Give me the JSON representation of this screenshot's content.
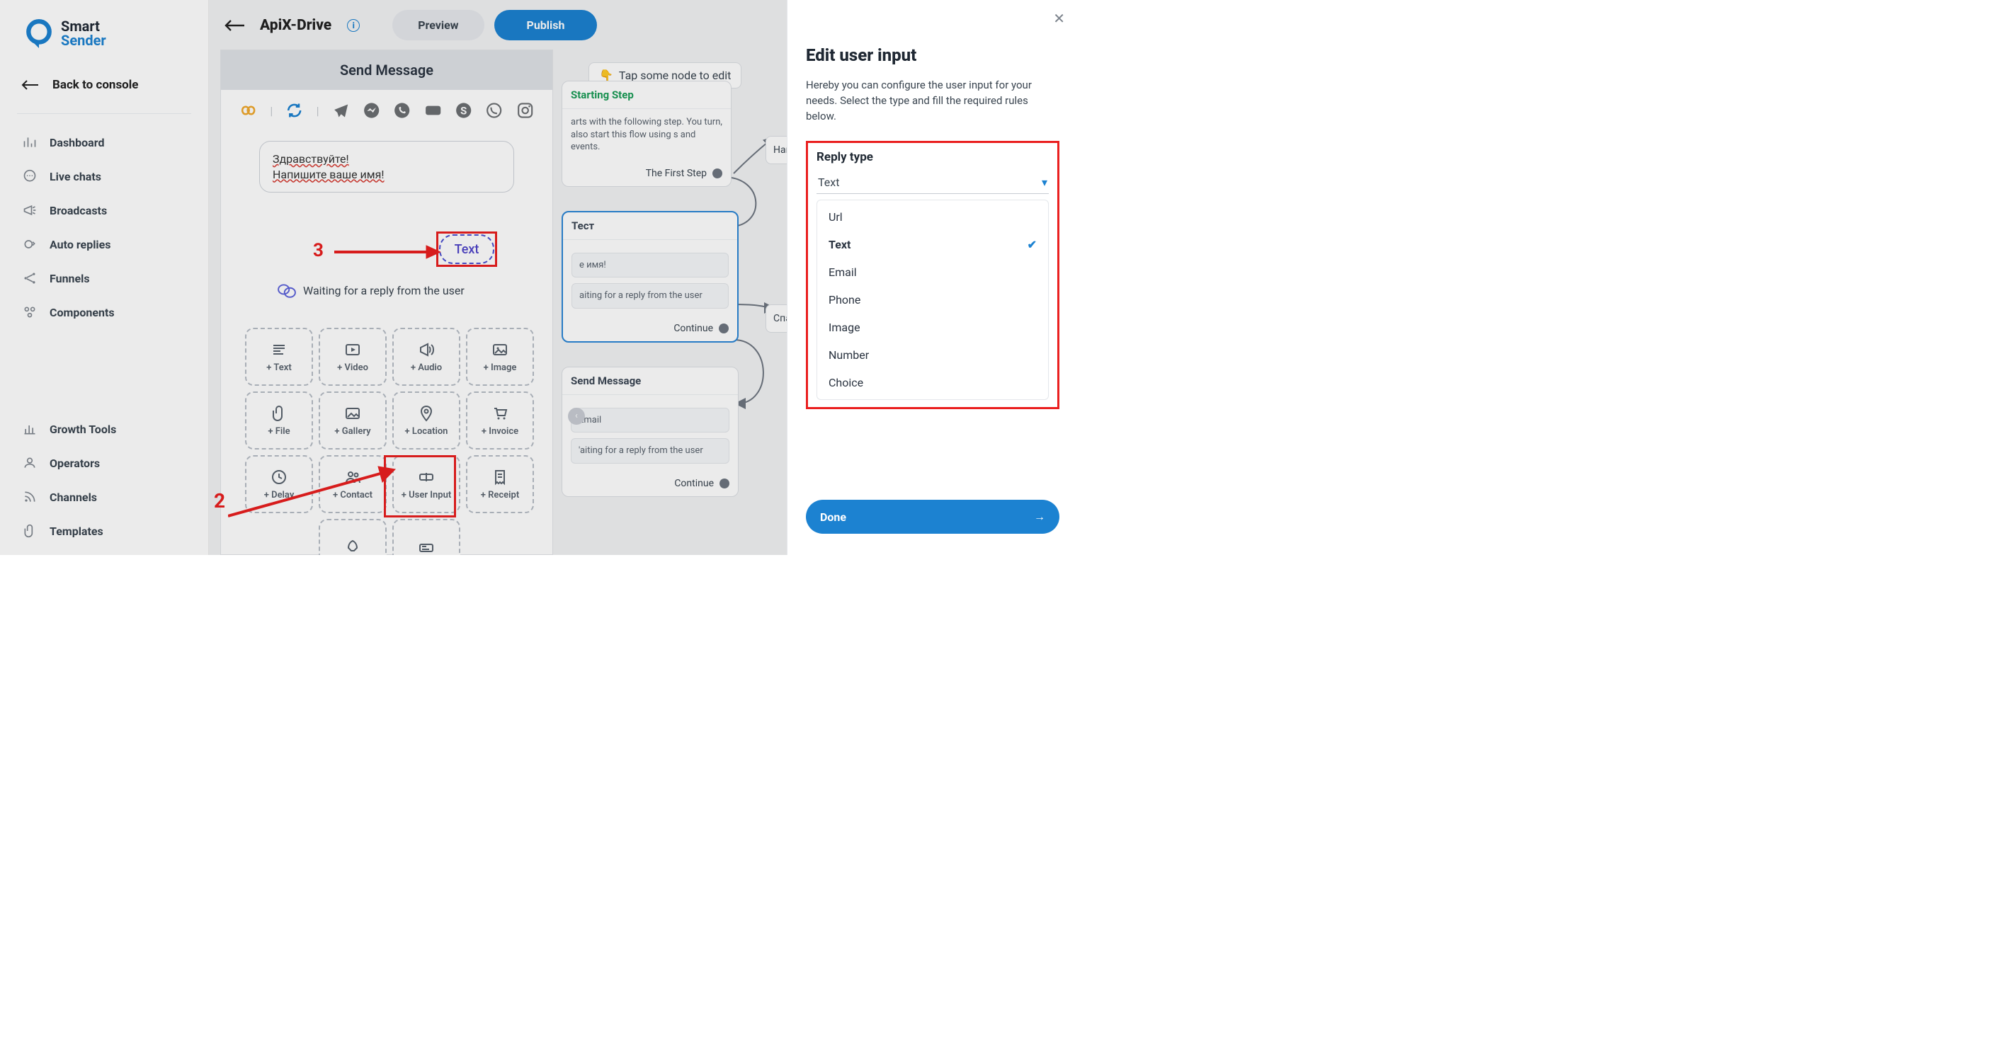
{
  "brand": {
    "l1": "Smart",
    "l2": "Sender"
  },
  "back_label": "Back to console",
  "nav": [
    "Dashboard",
    "Live chats",
    "Broadcasts",
    "Auto replies",
    "Funnels",
    "Components"
  ],
  "nav2": [
    "Growth Tools",
    "Operators",
    "Channels",
    "Templates"
  ],
  "top": {
    "title": "ApiX-Drive",
    "preview": "Preview",
    "publish": "Publish"
  },
  "toast": "Tap some node to edit",
  "send": {
    "header": "Send Message",
    "msg_l1": "Здравствуйте!",
    "msg_l2": "Напишите ваше имя!",
    "chip": "Text",
    "wait": "Waiting for a reply from the user"
  },
  "blocks": [
    "+ Text",
    "+ Video",
    "+ Audio",
    "+ Image",
    "+ File",
    "+ Gallery",
    "+ Location",
    "+ Invoice",
    "+ Delay",
    "+ Contact",
    "+ User Input",
    "+ Receipt"
  ],
  "flow": {
    "c1": {
      "hdr": "Starting Step",
      "body": "arts with the following step. You turn, also start this flow using s and events.",
      "foot": "The First Step"
    },
    "c2": {
      "hdr": "Тест",
      "p1": "е имя!",
      "p2": "aiting for a reply from the user",
      "foot": "Continue"
    },
    "c3": {
      "hdr": "Send Message",
      "p1": "Email",
      "p2": "'aiting for a reply from the user",
      "foot": "Continue"
    },
    "ext1": "Напиш",
    "ext2": "Спаси"
  },
  "panel": {
    "title": "Edit user input",
    "desc": "Hereby you can configure the user input for your needs. Select the type and fill the required rules below.",
    "reply_label": "Reply type",
    "selected": "Text",
    "options": [
      "Url",
      "Text",
      "Email",
      "Phone",
      "Image",
      "Number",
      "Choice"
    ],
    "done": "Done"
  },
  "annot": {
    "n2": "2",
    "n3": "3"
  }
}
